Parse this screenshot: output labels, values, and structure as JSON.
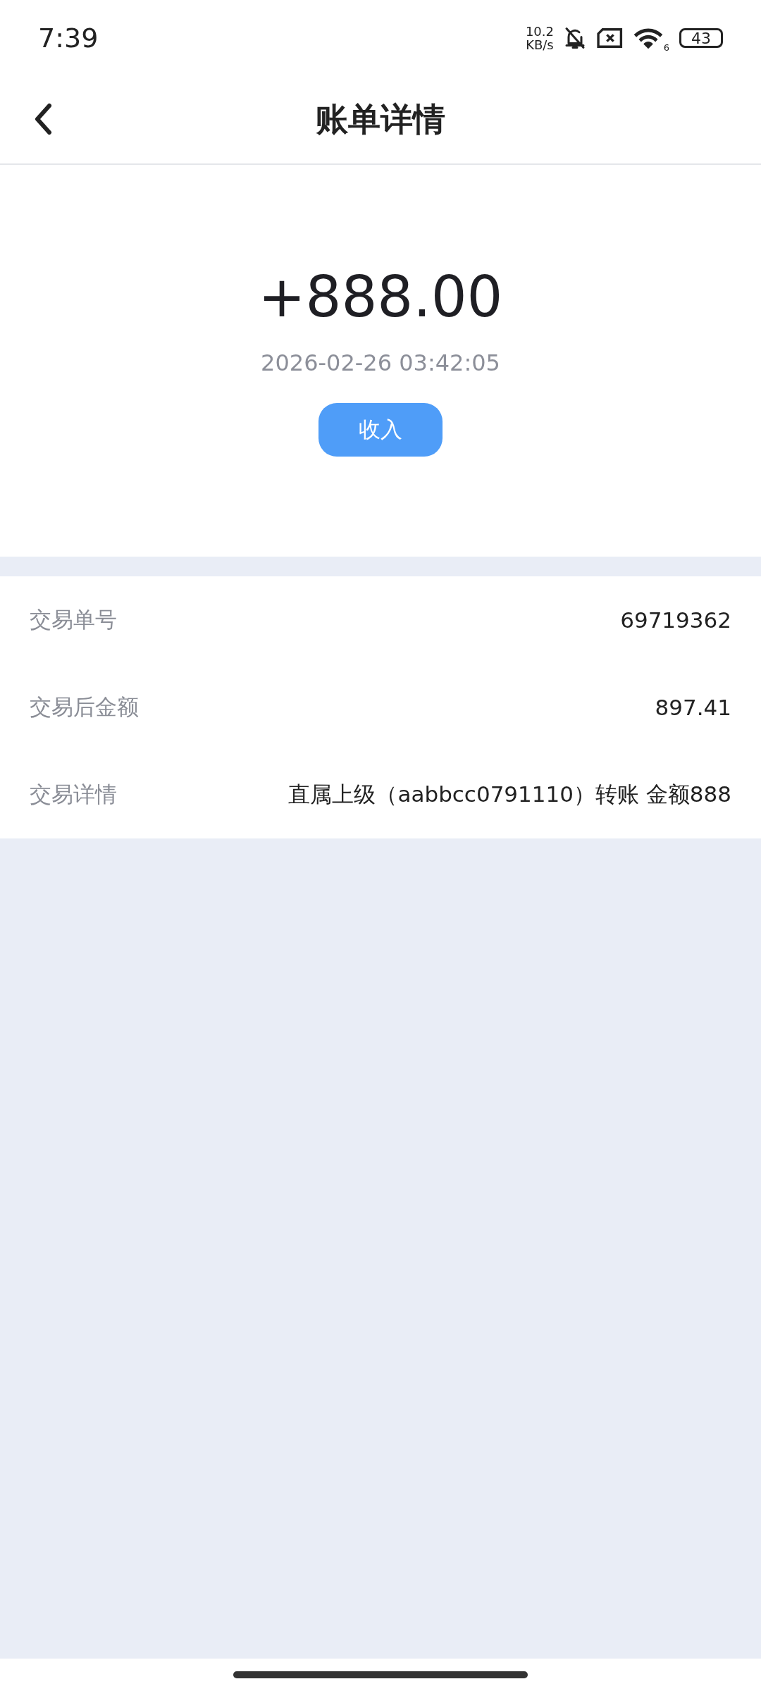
{
  "status_bar": {
    "time": "7:39",
    "net_speed_value": "10.2",
    "net_speed_unit": "KB/s",
    "wifi_badge": "6",
    "battery": "43"
  },
  "header": {
    "title": "账单详情"
  },
  "summary": {
    "amount": "+888.00",
    "datetime": "2026-02-26 03:42:05",
    "type_label": "收入"
  },
  "details": [
    {
      "label": "交易单号",
      "value": "69719362"
    },
    {
      "label": "交易后金额",
      "value": "897.41"
    },
    {
      "label": "交易详情",
      "value": "直属上级（aabbcc0791110）转账 金额888"
    }
  ]
}
